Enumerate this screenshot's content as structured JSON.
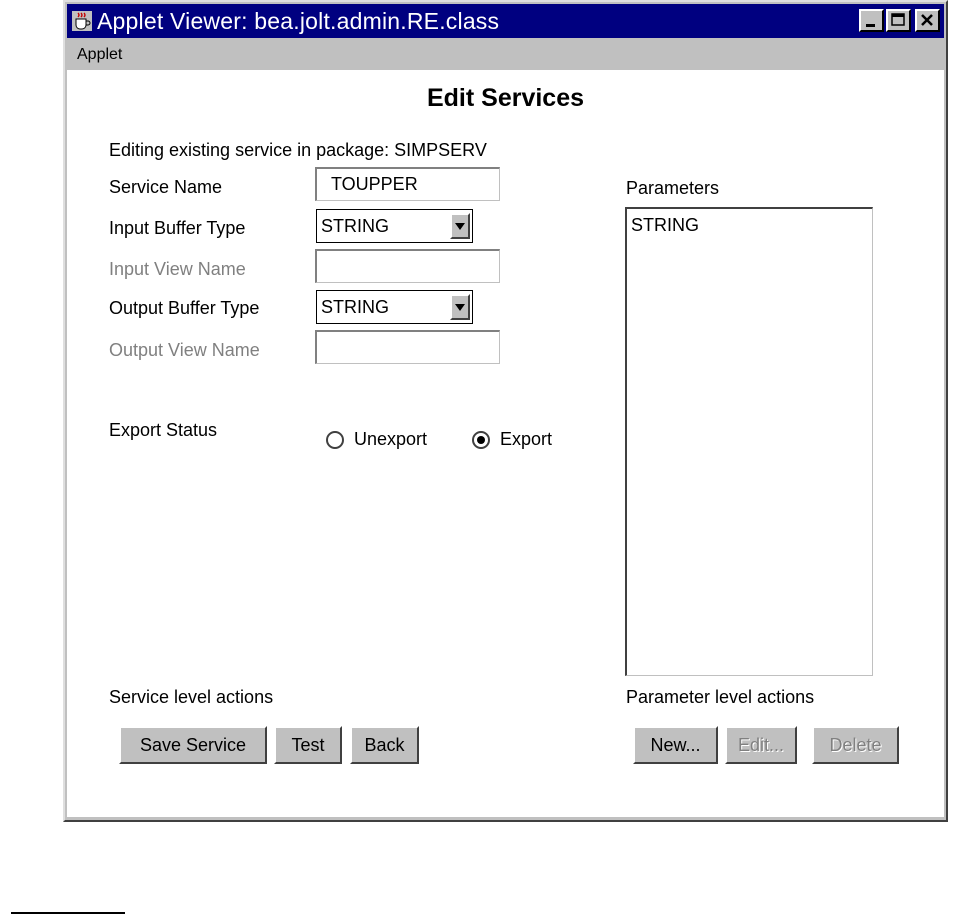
{
  "window": {
    "title": "Applet Viewer: bea.jolt.admin.RE.class",
    "icon": "java-cup-icon"
  },
  "menu": {
    "items": [
      "Applet"
    ]
  },
  "form": {
    "heading": "Edit Services",
    "subtitle": "Editing existing service in package: SIMPSERV",
    "service_name_label": "Service Name",
    "service_name_value": "TOUPPER",
    "input_buffer_label": "Input Buffer Type",
    "input_buffer_value": "STRING",
    "input_view_label": "Input View Name",
    "input_view_value": "",
    "output_buffer_label": "Output Buffer Type",
    "output_buffer_value": "STRING",
    "output_view_label": "Output View Name",
    "output_view_value": "",
    "export_status_label": "Export Status",
    "export_options": [
      {
        "label": "Unexport",
        "checked": false
      },
      {
        "label": "Export",
        "checked": true
      }
    ]
  },
  "parameters": {
    "label": "Parameters",
    "items": [
      "STRING"
    ]
  },
  "service_actions": {
    "label": "Service level actions",
    "save": "Save Service",
    "test": "Test",
    "back": "Back"
  },
  "parameter_actions": {
    "label": "Parameter level actions",
    "new": "New...",
    "edit": "Edit...",
    "delete": "Delete"
  }
}
